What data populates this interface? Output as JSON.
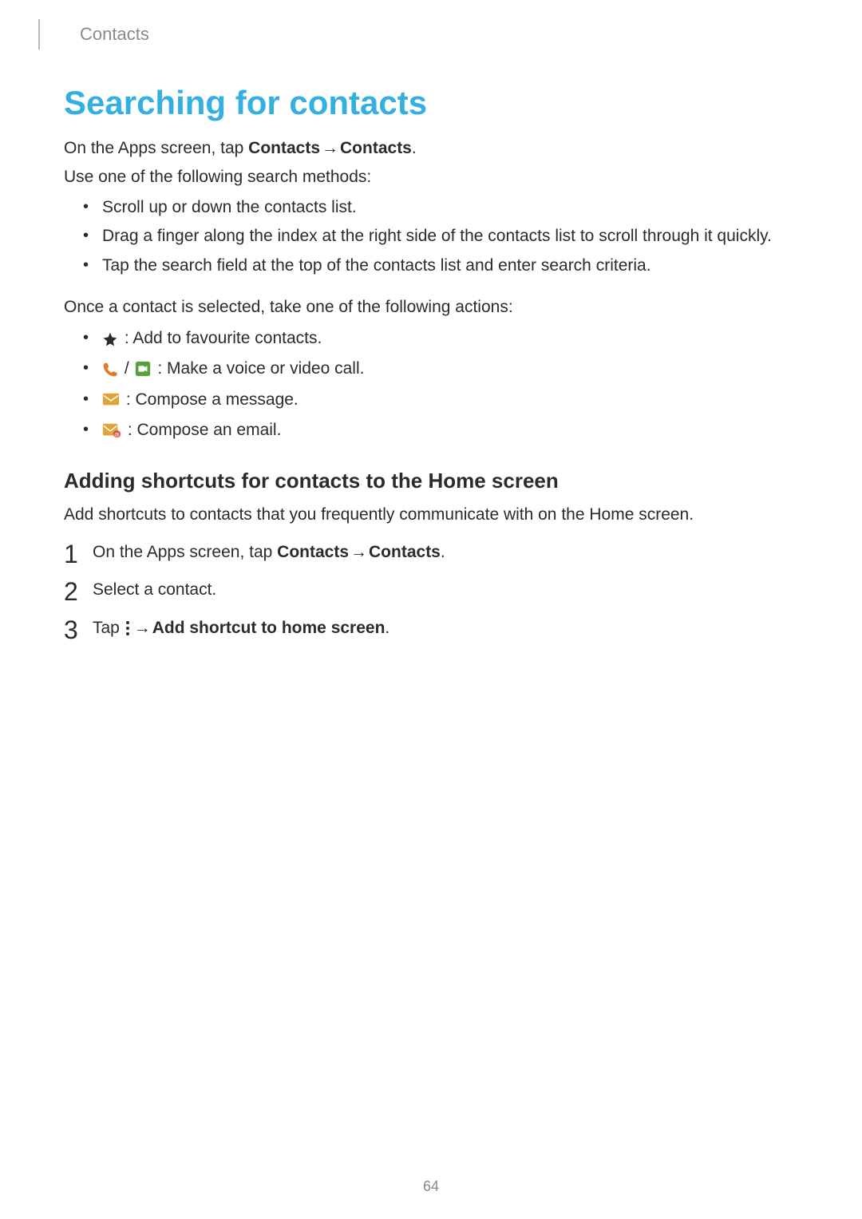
{
  "header": {
    "section": "Contacts"
  },
  "title": "Searching for contacts",
  "intro": {
    "line1_pre": "On the Apps screen, tap ",
    "line1_b1": "Contacts",
    "line1_arrow": " → ",
    "line1_b2": "Contacts",
    "line1_post": ".",
    "line2": "Use one of the following search methods:"
  },
  "methods": [
    "Scroll up or down the contacts list.",
    "Drag a finger along the index at the right side of the contacts list to scroll through it quickly.",
    "Tap the search field at the top of the contacts list and enter search criteria."
  ],
  "once_selected": "Once a contact is selected, take one of the following actions:",
  "actions": {
    "star": " : Add to favourite contacts.",
    "call_sep": " / ",
    "call": " : Make a voice or video call.",
    "msg": " : Compose a message.",
    "email": " : Compose an email."
  },
  "shortcut": {
    "heading": "Adding shortcuts for contacts to the Home screen",
    "desc": "Add shortcuts to contacts that you frequently communicate with on the Home screen.",
    "step1_pre": "On the Apps screen, tap ",
    "step1_b1": "Contacts",
    "step1_arrow": " → ",
    "step1_b2": "Contacts",
    "step1_post": ".",
    "step2": "Select a contact.",
    "step3_pre": "Tap ",
    "step3_arrow": " → ",
    "step3_b": "Add shortcut to home screen",
    "step3_post": "."
  },
  "page_number": "64"
}
